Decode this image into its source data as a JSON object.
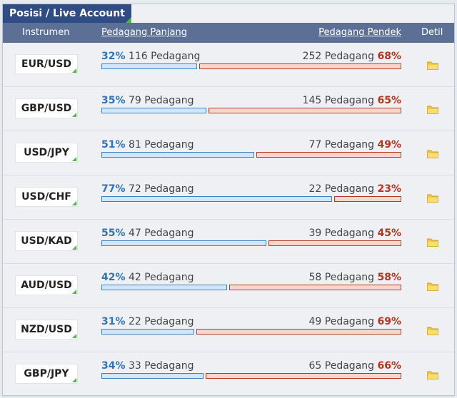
{
  "tab": {
    "title": "Posisi / Live Account"
  },
  "header": {
    "instrument": "Instrumen",
    "long": "Pedagang Panjang",
    "short": "Pedagang Pendek",
    "detail": "Detil"
  },
  "colors": {
    "tab_bg": "#2f4d84",
    "header_bg": "#5c7096",
    "long_text": "#2f74b7",
    "short_text": "#b6351f",
    "long_bar_fill": "#d3e6f7",
    "short_bar_fill": "#f8d6cb",
    "accent_green": "#4cb848"
  },
  "rows": [
    {
      "symbol": "EUR/USD",
      "long_pct": "32%",
      "long_count": "116 Pedagang",
      "short_count": "252 Pedagang",
      "short_pct": "68%",
      "long_frac": 0.32,
      "detail_icon": "folder-icon"
    },
    {
      "symbol": "GBP/USD",
      "long_pct": "35%",
      "long_count": "79 Pedagang",
      "short_count": "145 Pedagang",
      "short_pct": "65%",
      "long_frac": 0.35,
      "detail_icon": "folder-icon"
    },
    {
      "symbol": "USD/JPY",
      "long_pct": "51%",
      "long_count": "81 Pedagang",
      "short_count": "77 Pedagang",
      "short_pct": "49%",
      "long_frac": 0.51,
      "detail_icon": "folder-icon"
    },
    {
      "symbol": "USD/CHF",
      "long_pct": "77%",
      "long_count": "72 Pedagang",
      "short_count": "22 Pedagang",
      "short_pct": "23%",
      "long_frac": 0.77,
      "detail_icon": "folder-icon"
    },
    {
      "symbol": "USD/KAD",
      "long_pct": "55%",
      "long_count": "47 Pedagang",
      "short_count": "39 Pedagang",
      "short_pct": "45%",
      "long_frac": 0.55,
      "detail_icon": "folder-icon"
    },
    {
      "symbol": "AUD/USD",
      "long_pct": "42%",
      "long_count": "42 Pedagang",
      "short_count": "58 Pedagang",
      "short_pct": "58%",
      "long_frac": 0.42,
      "detail_icon": "folder-icon"
    },
    {
      "symbol": "NZD/USD",
      "long_pct": "31%",
      "long_count": "22 Pedagang",
      "short_count": "49 Pedagang",
      "short_pct": "69%",
      "long_frac": 0.31,
      "detail_icon": "folder-icon"
    },
    {
      "symbol": "GBP/JPY",
      "long_pct": "34%",
      "long_count": "33 Pedagang",
      "short_count": "65 Pedagang",
      "short_pct": "66%",
      "long_frac": 0.34,
      "detail_icon": "folder-icon"
    }
  ]
}
